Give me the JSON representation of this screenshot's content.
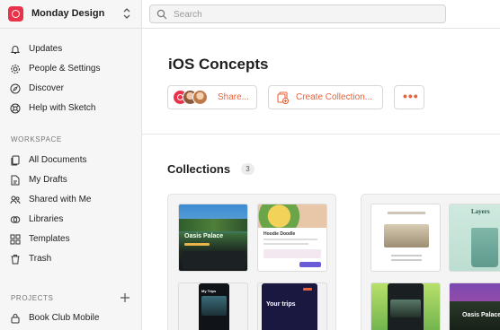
{
  "workspace": {
    "name": "Monday Design",
    "logo_icon": "sketch-workspace-icon",
    "brand_color": "#e8334a"
  },
  "sidebar": {
    "top_items": [
      {
        "label": "Updates",
        "icon": "bell-icon"
      },
      {
        "label": "People & Settings",
        "icon": "gear-icon"
      },
      {
        "label": "Discover",
        "icon": "compass-icon"
      },
      {
        "label": "Help with Sketch",
        "icon": "help-lifebuoy-icon"
      }
    ],
    "workspace_section": "WORKSPACE",
    "workspace_items": [
      {
        "label": "All Documents",
        "icon": "documents-icon"
      },
      {
        "label": "My Drafts",
        "icon": "drafts-icon"
      },
      {
        "label": "Shared with Me",
        "icon": "shared-icon"
      },
      {
        "label": "Libraries",
        "icon": "libraries-icon"
      },
      {
        "label": "Templates",
        "icon": "templates-icon"
      },
      {
        "label": "Trash",
        "icon": "trash-icon"
      }
    ],
    "projects_section": "PROJECTS",
    "project_items": [
      {
        "label": "Book Club Mobile",
        "icon": "lock-icon"
      }
    ]
  },
  "search": {
    "placeholder": "Search",
    "value": ""
  },
  "main": {
    "title": "iOS Concepts",
    "share_label": "Share...",
    "create_collection_label": "Create Collection...",
    "more_label": "•••",
    "collections_title": "Collections",
    "collections_count": "3",
    "thumbs": {
      "oasis_title": "Oasis Palace",
      "trips_title": "Your trips",
      "my_trips": "My Trips",
      "layers": "Layers",
      "hoodie": "Hoodie Doodle"
    }
  },
  "colors": {
    "accent": "#e8633a",
    "sidebar_bg": "#f6f6f6"
  }
}
